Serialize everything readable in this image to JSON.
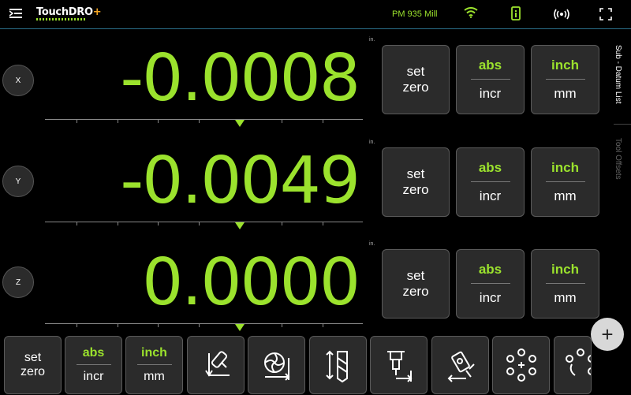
{
  "header": {
    "app_name": "TouchDRO",
    "app_name_suffix": "+",
    "machine_name": "PM 935 Mill",
    "icons": [
      "menu-icon",
      "wifi-icon",
      "device-icon",
      "broadcast-icon",
      "fullscreen-icon"
    ]
  },
  "colors": {
    "accent": "#9be22d",
    "background": "#000000",
    "button": "#2b2b2b",
    "logo_plus": "#f5a623"
  },
  "axes": [
    {
      "label": "X",
      "value": "-0.0008",
      "unit": "in.",
      "set_zero": [
        "set",
        "zero"
      ],
      "abs": "abs",
      "incr": "incr",
      "inch": "inch",
      "mm": "mm"
    },
    {
      "label": "Y",
      "value": "-0.0049",
      "unit": "in.",
      "set_zero": [
        "set",
        "zero"
      ],
      "abs": "abs",
      "incr": "incr",
      "inch": "inch",
      "mm": "mm"
    },
    {
      "label": "Z",
      "value": "0.0000",
      "unit": "in.",
      "set_zero": [
        "set",
        "zero"
      ],
      "abs": "abs",
      "incr": "incr",
      "inch": "inch",
      "mm": "mm"
    }
  ],
  "side_tabs": [
    "Sub - Datum  List",
    "Tool  Offsets"
  ],
  "toolbar": {
    "set_zero": [
      "set",
      "zero"
    ],
    "abs": "abs",
    "incr": "incr",
    "inch": "inch",
    "mm": "mm",
    "tool_icons": [
      "edge-finder-icon",
      "end-mill-icon",
      "tool-length-icon",
      "tool-offset-icon",
      "probe-icon",
      "bolt-circle-icon",
      "bolt-circle-partial-icon"
    ]
  },
  "fab_label": "+"
}
